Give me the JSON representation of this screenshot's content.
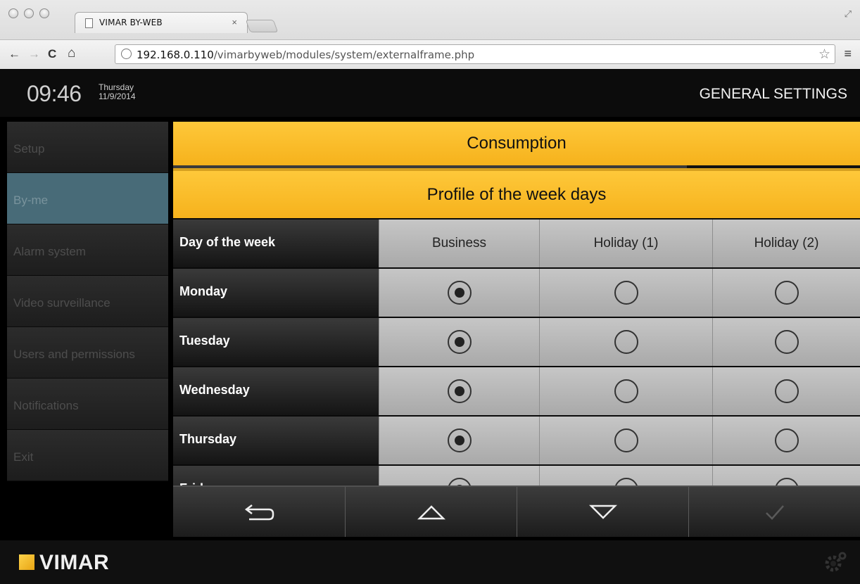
{
  "browser": {
    "tab_title": "VIMAR BY-WEB",
    "tab_close": "×",
    "url_host": "192.168.0.110",
    "url_path": "/vimarbyweb/modules/system/externalframe.php"
  },
  "header": {
    "time": "09:46",
    "weekday": "Thursday",
    "date": "11/9/2014",
    "section_title": "GENERAL SETTINGS"
  },
  "sidebar": {
    "items": [
      {
        "label": "Setup"
      },
      {
        "label": "By-me"
      },
      {
        "label": "Alarm system"
      },
      {
        "label": "Video surveillance"
      },
      {
        "label": "Users and permissions"
      },
      {
        "label": "Notifications"
      },
      {
        "label": "Exit"
      }
    ],
    "active_index": 1
  },
  "main": {
    "category_title": "Consumption",
    "page_title": "Profile of the week days",
    "columns": [
      "Day of the week",
      "Business",
      "Holiday (1)",
      "Holiday (2)"
    ],
    "rows": [
      {
        "day": "Monday",
        "selected": 0
      },
      {
        "day": "Tuesday",
        "selected": 0
      },
      {
        "day": "Wednesday",
        "selected": 0
      },
      {
        "day": "Thursday",
        "selected": 0
      },
      {
        "day": "Friday",
        "selected": 0
      }
    ]
  },
  "bottom_bar": {
    "buttons": [
      "back-icon",
      "up-arrow-icon",
      "down-arrow-icon",
      "checkmark-icon"
    ]
  },
  "footer": {
    "brand": "VIMAR"
  }
}
